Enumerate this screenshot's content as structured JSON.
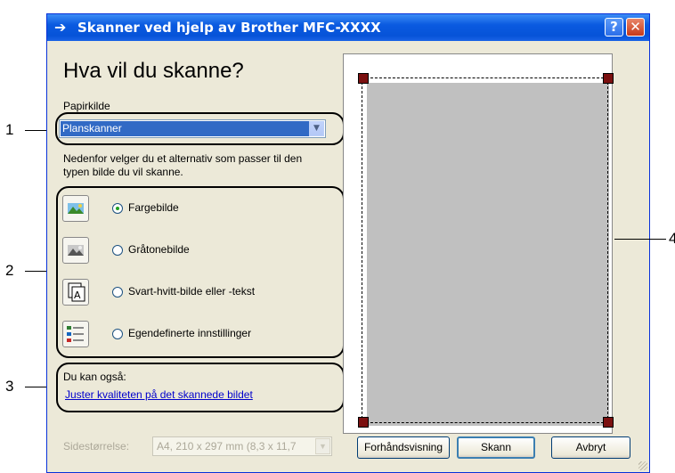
{
  "callouts": [
    "1",
    "2",
    "3",
    "4"
  ],
  "window": {
    "title": "Skanner ved hjelp av Brother MFC-XXXX",
    "help_symbol": "?",
    "close_symbol": "✕"
  },
  "heading": "Hva vil du skanne?",
  "paper_source": {
    "label": "Papirkilde",
    "value": "Planskanner"
  },
  "instruction": [
    "Nedenfor velger du et alternativ som passer til den",
    "typen bilde du vil skanne."
  ],
  "options": [
    {
      "label": "Fargebilde",
      "icon": "color-photo-icon",
      "selected": true
    },
    {
      "label": "Gråtonebilde",
      "icon": "grayscale-photo-icon",
      "selected": false
    },
    {
      "label": "Svart-hvitt-bilde eller -tekst",
      "icon": "black-white-text-icon",
      "selected": false
    },
    {
      "label": "Egendefinerte innstillinger",
      "icon": "custom-settings-icon",
      "selected": false
    }
  ],
  "also": {
    "label": "Du kan også:",
    "link": "Juster kvaliteten på det skannede bildet"
  },
  "page_size": {
    "label": "Sidestørrelse:",
    "value": "A4, 210 x 297 mm (8,3 x 11,7"
  },
  "buttons": {
    "preview": "Forhåndsvisning",
    "scan": "Skann",
    "cancel": "Avbryt"
  },
  "colors": {
    "titlebar": "#0a5ae0",
    "dialog": "#ece9d8",
    "selection": "#316ac5",
    "preview_area": "#c0c0c0",
    "handle": "#7b1010"
  }
}
